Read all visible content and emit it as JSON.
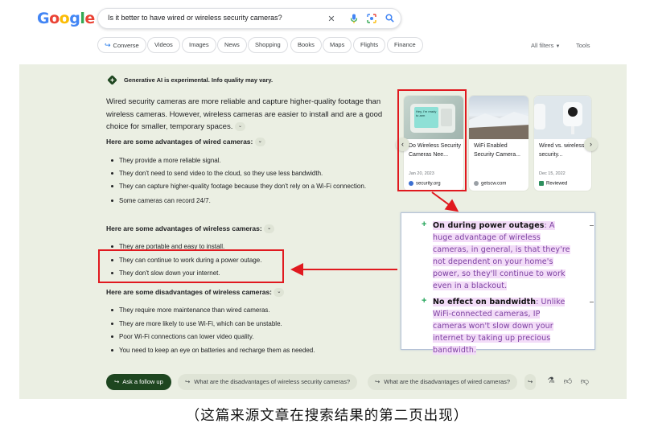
{
  "header": {
    "logo_letters": [
      {
        "char": "G",
        "color": "#4285f4"
      },
      {
        "char": "o",
        "color": "#ea4335"
      },
      {
        "char": "o",
        "color": "#fbbc05"
      },
      {
        "char": "g",
        "color": "#4285f4"
      },
      {
        "char": "l",
        "color": "#34a853"
      },
      {
        "char": "e",
        "color": "#ea4335"
      }
    ],
    "query": "Is it better to have wired or wireless security cameras?",
    "icons": [
      "close-icon",
      "mic-icon",
      "lens-icon",
      "search-icon"
    ]
  },
  "tabs": {
    "converse": "Converse",
    "videos": "Videos",
    "images": "Images",
    "news": "News",
    "shopping": "Shopping",
    "books": "Books",
    "maps": "Maps",
    "flights": "Flights",
    "finance": "Finance",
    "all_filters": "All filters",
    "tools": "Tools"
  },
  "overview": {
    "notice": "Generative AI is experimental. Info quality may vary.",
    "intro": "Wired security cameras are more reliable and capture higher-quality footage than wireless cameras. However, wireless cameras are easier to install and are a good choice for smaller, temporary spaces.",
    "wired_heading": "Here are some advantages of wired cameras:",
    "wired_items": [
      "They provide a more reliable signal.",
      "They don't need to send video to the cloud, so they use less bandwidth.",
      "They can capture higher-quality footage because they don't rely on a Wi-Fi connection.",
      "Some cameras can record 24/7."
    ],
    "wireless_heading": "Here are some advantages of wireless cameras:",
    "wireless_items": [
      "They are portable and easy to install.",
      "They can continue to work during a power outage.",
      "They don't slow down your internet."
    ],
    "disadv_heading": "Here are some disadvantages of wireless cameras:",
    "disadv_items": [
      "They require more maintenance than wired cameras.",
      "They are more likely to use Wi-Fi, which can be unstable.",
      "Poor Wi-Fi connections can lower video quality.",
      "You need to keep an eye on batteries and recharge them as needed."
    ]
  },
  "sources": [
    {
      "title": "Do Wireless Security Cameras Nee...",
      "date": "Jan 20, 2023",
      "site": "security.org",
      "icon": "globe-icon"
    },
    {
      "title": "WiFi Enabled Security Camera...",
      "date": "",
      "site": "getscw.com",
      "icon": "globe-icon"
    },
    {
      "title": "Wired vs. wireless security...",
      "date": "Dec 15, 2022",
      "site": "Reviewed",
      "icon": "check-icon"
    }
  ],
  "card_screen_text": "Hey, I'm ready to arm",
  "excerpt": {
    "p1_bold": "On during power outages",
    "p1_text": ": A huge advantage of wireless cameras, in general, is that they're not dependent on your home's power, so they'll continue to work even in a blackout.",
    "p2_bold": "No effect on bandwidth",
    "p2_text": ": Unlike WiFi-connected cameras, IP cameras won't slow down your internet by taking up precious bandwidth."
  },
  "followups": {
    "ask": "Ask a follow up",
    "s1": "What are the disadvantages of wireless security cameras?",
    "s2": "What are the disadvantages of wired cameras?"
  },
  "caption": "（这篇来源文章在搜索结果的第二页出现）",
  "colors": {
    "panel_bg": "#ebefe3",
    "annotation_red": "#e0191f",
    "highlight_purple": "#f3dcf8",
    "followup_green": "#1e4620"
  }
}
